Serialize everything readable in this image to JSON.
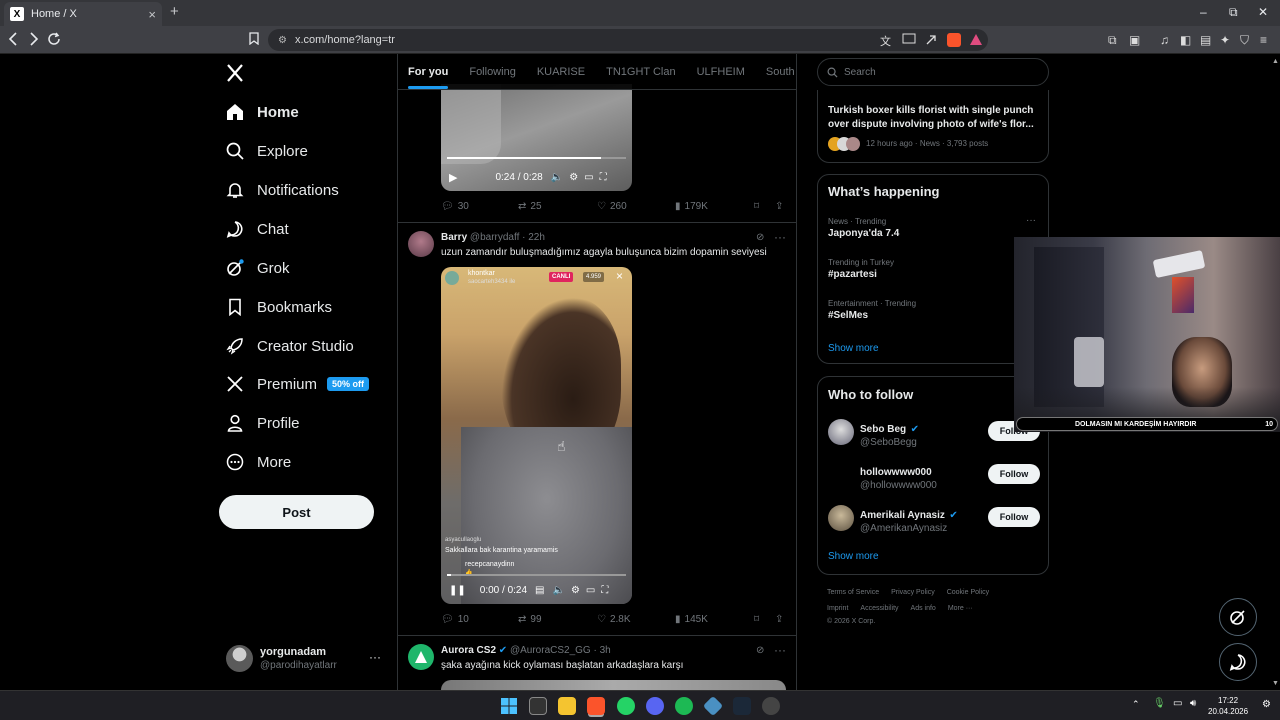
{
  "browser": {
    "tab_title": "Home / X",
    "tab_favicon": "X",
    "url": "x.com/home?lang=tr"
  },
  "nav": {
    "items": [
      {
        "label": "Home",
        "icon": "home-icon"
      },
      {
        "label": "Explore",
        "icon": "search-icon"
      },
      {
        "label": "Notifications",
        "icon": "bell-icon"
      },
      {
        "label": "Chat",
        "icon": "chat-icon"
      },
      {
        "label": "Grok",
        "icon": "grok-icon"
      },
      {
        "label": "Bookmarks",
        "icon": "bookmark-icon"
      },
      {
        "label": "Creator Studio",
        "icon": "rocket-icon"
      },
      {
        "label": "Premium",
        "icon": "x-icon"
      },
      {
        "label": "Profile",
        "icon": "person-icon"
      },
      {
        "label": "More",
        "icon": "more-circle-icon"
      }
    ],
    "premium_badge": "50% off",
    "post_label": "Post",
    "account": {
      "name": "yorgunadam",
      "handle": "@parodihayatlarr",
      "more": "···"
    }
  },
  "feed": {
    "tabs": [
      "For you",
      "Following",
      "KUARISE",
      "TN1GHT Clan",
      "ULFHEIM",
      "South Side"
    ],
    "tweet0": {
      "video_time": "0:24 / 0:28",
      "replies": "30",
      "reposts": "25",
      "likes": "260",
      "views": "179K"
    },
    "tweet1": {
      "name": "Barry",
      "handle": "@barrydaff",
      "time": "· 22h",
      "text": "uzun zamandır buluşmadığımız agayla buluşunca bizim dopamin seviyesi",
      "live_label": "CANLI",
      "live_viewers": "4.959",
      "live_user": "khontkar",
      "live_sub": "saocarteh3434 ile",
      "chat": [
        {
          "user": "asyacullaoglu",
          "msg": "Sakkallara bak karantina yaramamis"
        },
        {
          "user": "recepcanaydinn",
          "msg": "👍"
        }
      ],
      "video_time": "0:00 / 0:24",
      "replies": "10",
      "reposts": "99",
      "likes": "2.8K",
      "views": "145K"
    },
    "tweet2": {
      "name": "Aurora CS2",
      "handle": "@AuroraCS2_GG",
      "time": "· 3h",
      "text": "şaka ayağına kick oylaması başlatan arkadaşlara karşı"
    }
  },
  "right": {
    "search_placeholder": "Search",
    "news": {
      "headline": "Turkish boxer kills florist with single punch over dispute involving photo of wife's flor...",
      "meta": "12 hours ago · News · 3,793 posts"
    },
    "happening": {
      "title": "What’s happening",
      "trends": [
        {
          "meta": "News · Trending",
          "name": "Japonya'da 7.4"
        },
        {
          "meta": "Trending in Turkey",
          "name": "#pazartesi"
        },
        {
          "meta": "Entertainment · Trending",
          "name": "#SelMes"
        }
      ],
      "show_more": "Show more"
    },
    "who_to_follow": {
      "title": "Who to follow",
      "users": [
        {
          "name": "Sebo Beg",
          "handle": "@SeboBegg",
          "verified": true
        },
        {
          "name": "hollowwww000",
          "handle": "@hollowwww000",
          "verified": false
        },
        {
          "name": "Amerikali Aynasiz",
          "handle": "@AmerikanAynasiz",
          "verified": true
        }
      ],
      "follow_label": "Follow",
      "show_more": "Show more"
    },
    "footer": {
      "line1": [
        "Terms of Service",
        "Privacy Policy",
        "Cookie Policy"
      ],
      "line2": [
        "Imprint",
        "Accessibility",
        "Ads info",
        "More ···"
      ],
      "copyright": "© 2026 X Corp."
    }
  },
  "webcam": {
    "banner": "DOLMASIN MI KARDEŞİM HAYIRDIR",
    "counter": "10"
  },
  "taskbar": {
    "time": "17:22",
    "date": "20.04.2026"
  },
  "colors": {
    "accent": "#1d9bf0",
    "background": "#000000",
    "border": "#2f3336",
    "muted": "#71767b",
    "live": "#e0245e"
  }
}
